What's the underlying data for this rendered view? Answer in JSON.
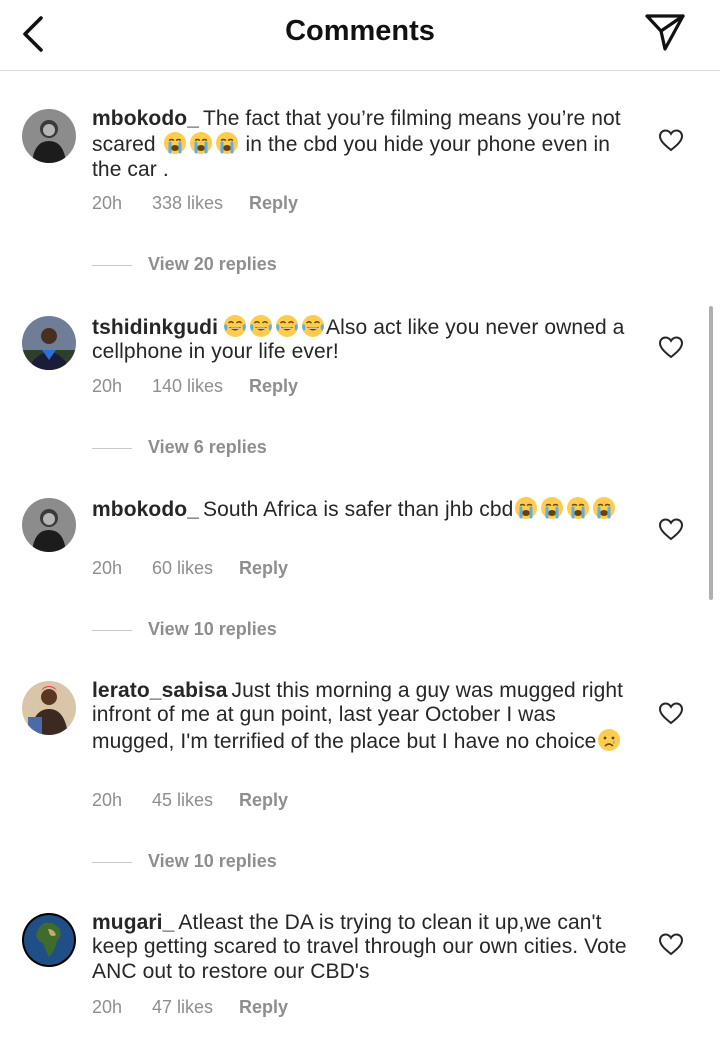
{
  "header": {
    "title": "Comments",
    "back_icon": "chevron-left-icon",
    "share_icon": "paper-plane-icon"
  },
  "comments": [
    {
      "username": "mbokodo_",
      "text_parts": [
        "The fact that you’re filming means you’re not scared ",
        " in the cbd you hide your phone even in the car ."
      ],
      "time": "20h",
      "likes": "338 likes",
      "reply": "Reply",
      "view_replies": "View 20 replies"
    },
    {
      "username": "tshidinkgudi",
      "text_parts": [
        "",
        "Also act like you never owned a cellphone in your life ever!"
      ],
      "time": "20h",
      "likes": "140 likes",
      "reply": "Reply",
      "view_replies": "View 6 replies"
    },
    {
      "username": "mbokodo_",
      "text_parts": [
        "South Africa is safer than jhb cbd",
        ""
      ],
      "time": "20h",
      "likes": "60 likes",
      "reply": "Reply",
      "view_replies": "View 10 replies"
    },
    {
      "username": "lerato_sabisa",
      "text_parts": [
        "Just this morning a guy was mugged right infront of me at gun point, last year October I was mugged, I'm terrified of the place but I have no choice",
        ""
      ],
      "time": "20h",
      "likes": "45 likes",
      "reply": "Reply",
      "view_replies": "View 10 replies"
    },
    {
      "username": "mugari_",
      "text_parts": [
        "Atleast the DA is trying to clean it up,we can't keep getting scared to travel through our own cities. Vote ANC out to restore our CBD's"
      ],
      "time": "20h",
      "likes": "47 likes",
      "reply": "Reply"
    }
  ],
  "colors": {
    "text": "#262626",
    "meta": "#8e8e8e",
    "divider": "#dbdbdb",
    "emoji_face": "#FFCC4D",
    "tears": "#5DADEC"
  }
}
